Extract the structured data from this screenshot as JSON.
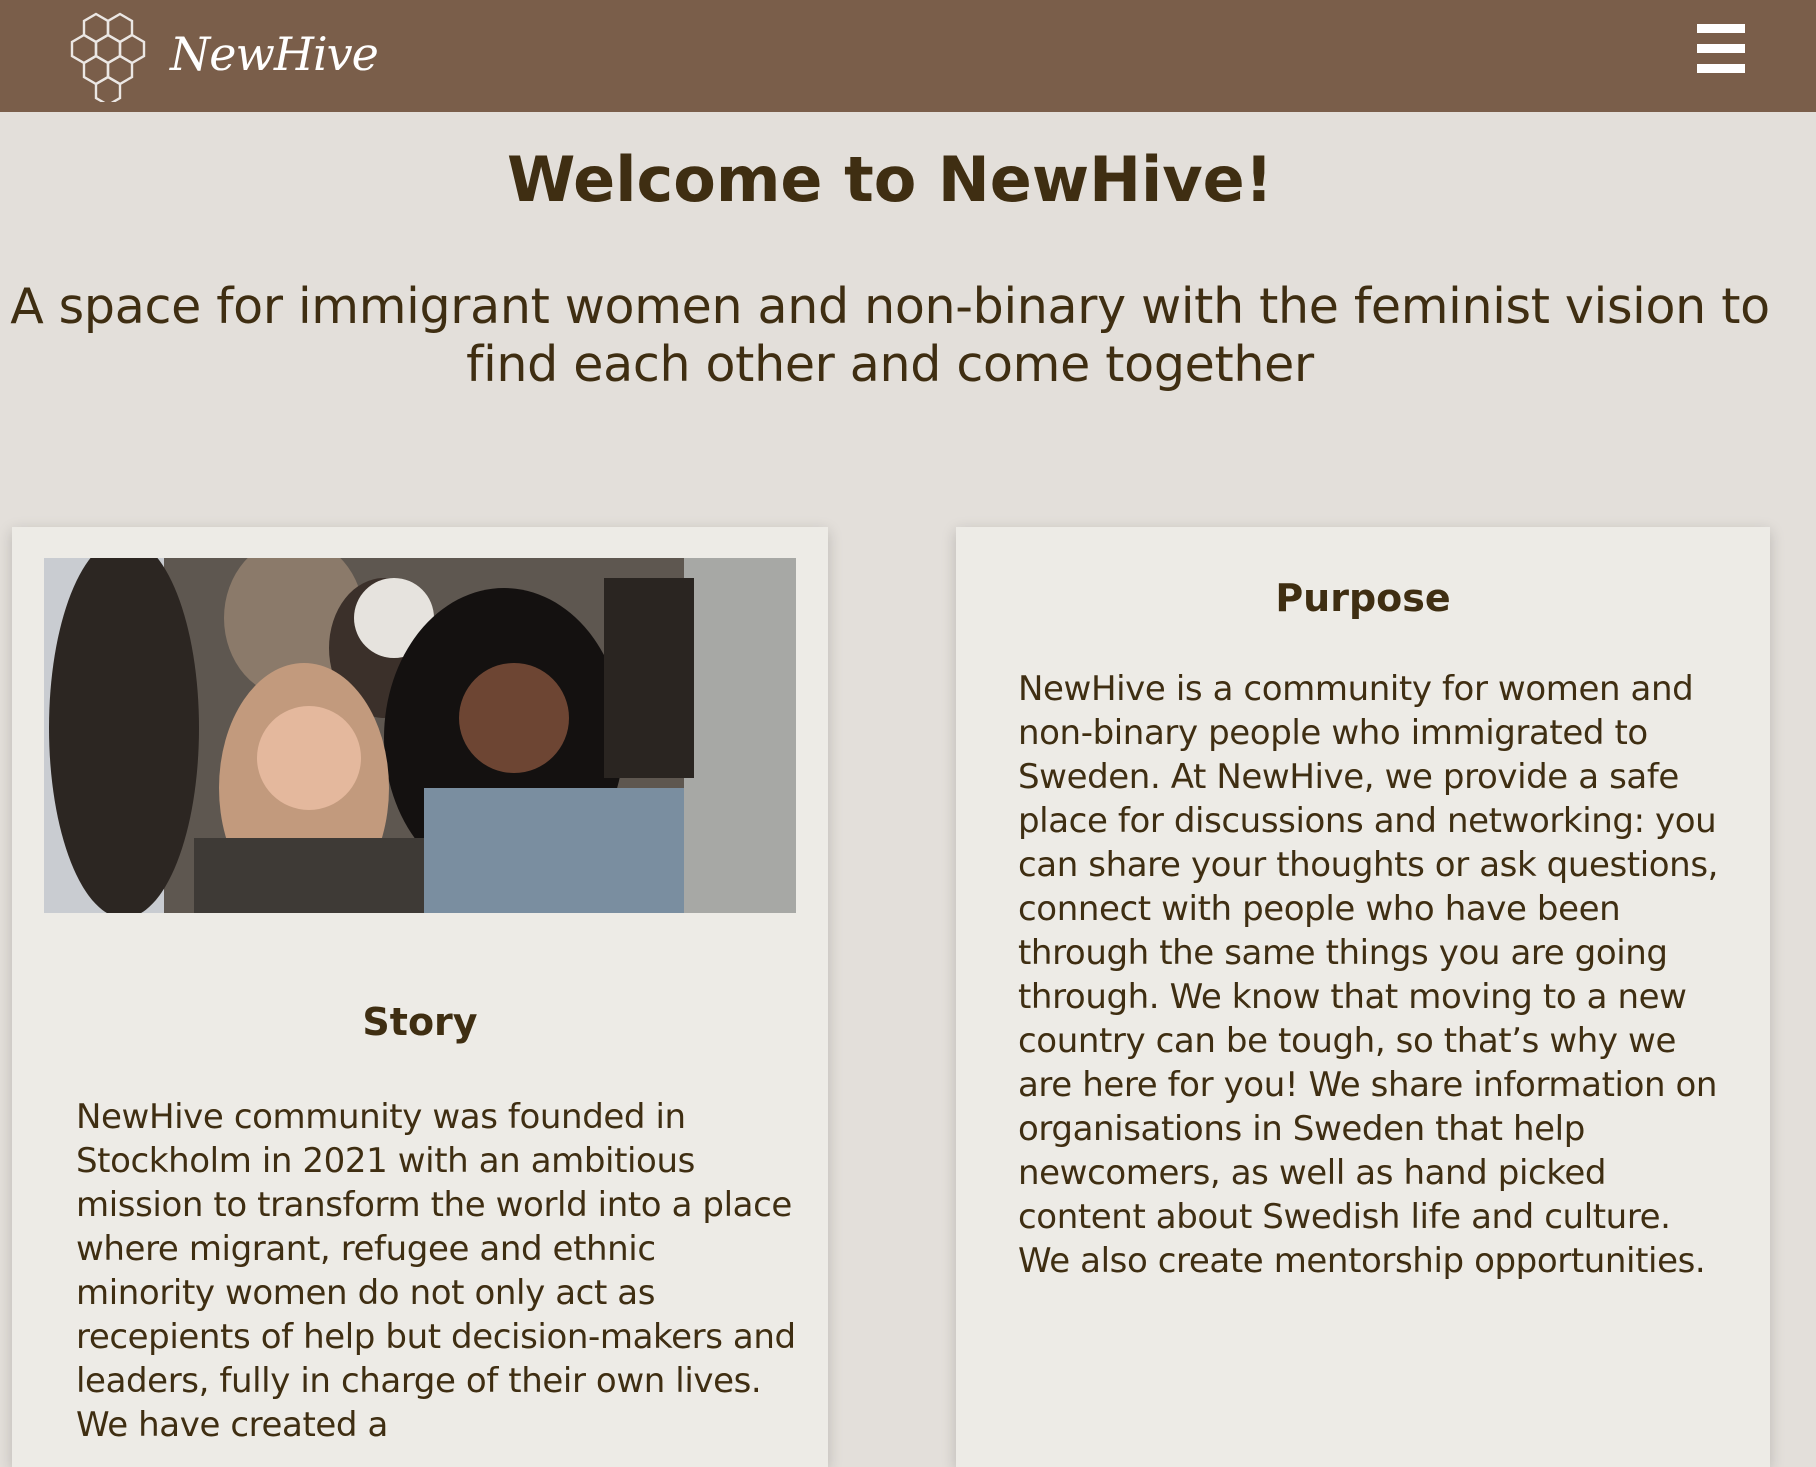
{
  "header": {
    "brand_name": "NewHive",
    "logo_icon": "honeycomb-logo-icon",
    "menu_icon": "hamburger-menu-icon",
    "background_color": "#7a5e4a"
  },
  "hero": {
    "title": "Welcome to NewHive!",
    "tagline": "A space for immigrant women and non-binary with the feminist vision to find each other and come together"
  },
  "story": {
    "heading": "Story",
    "body": "NewHive community was founded in Stockholm in 2021 with an ambitious mission to transform the world into a place where migrant, refugee and ethnic minority women do not only act as recepients of help but decision-makers and leaders, fully in charge of their own lives. We have created a"
  },
  "purpose": {
    "heading": "Purpose",
    "body": "NewHive is a community for women and non-binary people who immigrated to Sweden. At NewHive, we provide a safe place for discussions and networking: you can share your thoughts or ask questions, connect with people who have been through the same things you are going through. We know that moving to a new country can be tough, so that’s why we are here for you! We share information on organisations in Sweden that help newcomers, as well as hand picked content about Swedish life and culture. We also create mentorship opportunities."
  },
  "colors": {
    "page_background": "#e3dfda",
    "card_background": "#edebe6",
    "text": "#3f2e12"
  }
}
